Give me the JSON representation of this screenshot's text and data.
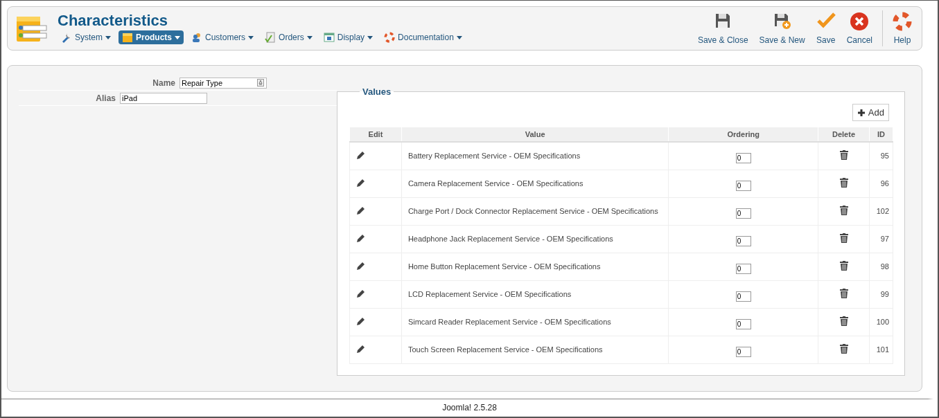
{
  "header": {
    "title": "Characteristics",
    "menu": [
      {
        "label": "System",
        "selected": false,
        "kind": "tools"
      },
      {
        "label": "Products",
        "selected": true,
        "kind": "box"
      },
      {
        "label": "Customers",
        "selected": false,
        "kind": "users"
      },
      {
        "label": "Orders",
        "selected": false,
        "kind": "orders"
      },
      {
        "label": "Display",
        "selected": false,
        "kind": "display"
      },
      {
        "label": "Documentation",
        "selected": false,
        "kind": "help"
      }
    ],
    "toolbar": [
      {
        "label": "Save & Close",
        "kind": "save"
      },
      {
        "label": "Save & New",
        "kind": "savenew"
      },
      {
        "label": "Save",
        "kind": "check"
      },
      {
        "label": "Cancel",
        "kind": "cancel"
      },
      {
        "label": "Help",
        "kind": "help"
      }
    ]
  },
  "form": {
    "fields": [
      {
        "label": "Name",
        "value": "Repair Type",
        "kind": "translatable"
      },
      {
        "label": "Alias",
        "value": "iPad",
        "kind": "plain"
      }
    ]
  },
  "values": {
    "legend": "Values",
    "add_button": "Add",
    "columns": [
      "Edit",
      "Value",
      "Ordering",
      "Delete",
      "ID"
    ],
    "rows": [
      {
        "value": "Battery Replacement Service - OEM Specifications",
        "ordering": "0",
        "id": "95"
      },
      {
        "value": "Camera Replacement Service - OEM Specifications",
        "ordering": "0",
        "id": "96"
      },
      {
        "value": "Charge Port / Dock Connector Replacement Service - OEM Specifications",
        "ordering": "0",
        "id": "102"
      },
      {
        "value": "Headphone Jack Replacement Service - OEM Specifications",
        "ordering": "0",
        "id": "97"
      },
      {
        "value": "Home Button Replacement Service - OEM Specifications",
        "ordering": "0",
        "id": "98"
      },
      {
        "value": "LCD Replacement Service - OEM Specifications",
        "ordering": "0",
        "id": "99"
      },
      {
        "value": "Simcard Reader Replacement Service - OEM Specifications",
        "ordering": "0",
        "id": "100"
      },
      {
        "value": "Touch Screen Replacement Service - OEM Specifications",
        "ordering": "0",
        "id": "101"
      }
    ]
  },
  "footer": "Joomla! 2.5.28"
}
